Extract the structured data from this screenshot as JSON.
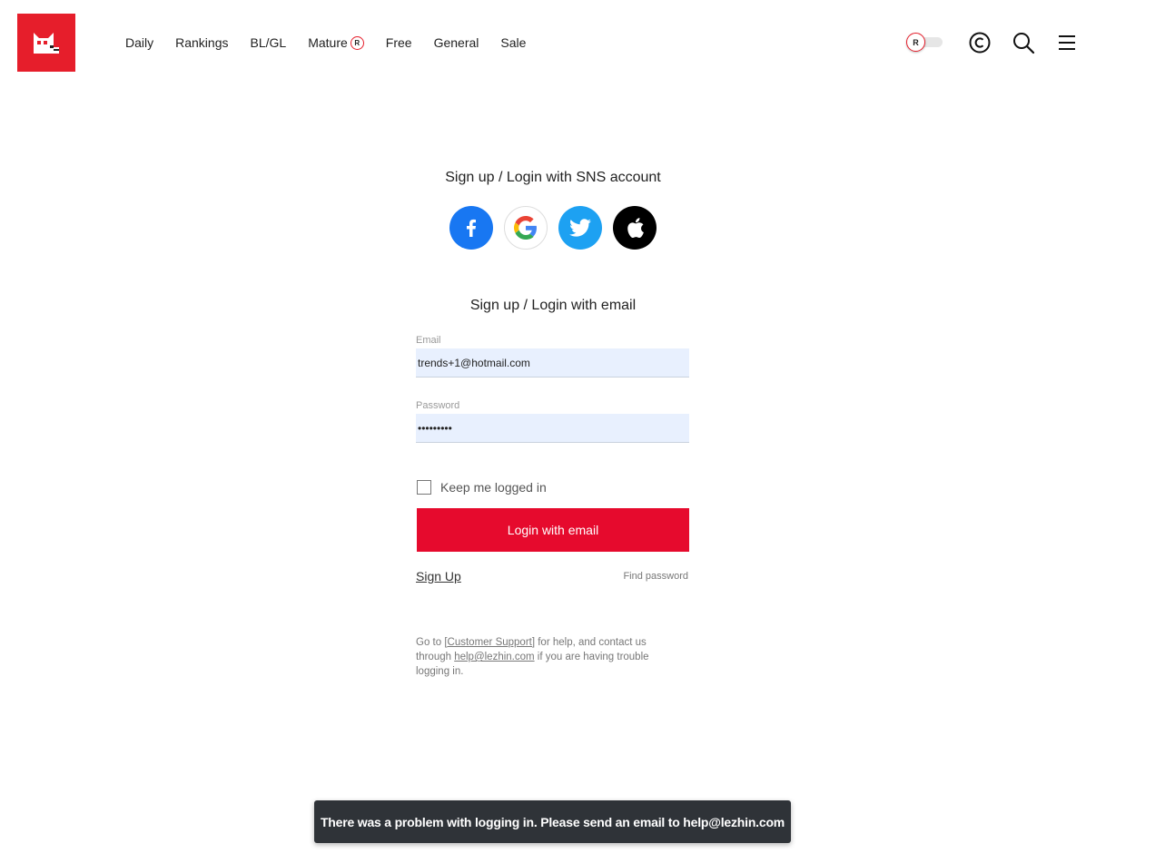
{
  "brand": {
    "accent_color": "#e61e2b",
    "logo_icon": "cat-logo-icon"
  },
  "nav": {
    "items": [
      {
        "label": "Daily"
      },
      {
        "label": "Rankings"
      },
      {
        "label": "BL/GL"
      },
      {
        "label": "Mature",
        "badge": "R"
      },
      {
        "label": "Free"
      },
      {
        "label": "General"
      },
      {
        "label": "Sale"
      }
    ]
  },
  "header": {
    "mature_toggle": {
      "badge": "R",
      "on": false
    },
    "icons": [
      "copyright-icon",
      "search-icon",
      "hamburger-menu-icon"
    ]
  },
  "sns": {
    "title": "Sign up / Login with SNS account",
    "providers": [
      {
        "name": "facebook-icon",
        "color": "#1877f2"
      },
      {
        "name": "google-icon",
        "color": "#ffffff"
      },
      {
        "name": "twitter-icon",
        "color": "#1da1f2"
      },
      {
        "name": "apple-icon",
        "color": "#000000"
      }
    ]
  },
  "email_login": {
    "title": "Sign up / Login with email",
    "email_label": "Email",
    "email_value": "trends+1@hotmail.com",
    "password_label": "Password",
    "password_value": "•••••••••",
    "keep_logged_in": "Keep me logged in",
    "login_button": "Login with email",
    "sign_up": "Sign Up",
    "find_password": "Find password"
  },
  "help": {
    "prefix": "Go to ",
    "support_link": "[Customer Support]",
    "middle": " for help, and contact us through ",
    "email_link": "help@lezhin.com",
    "suffix": " if you are having trouble logging in."
  },
  "toast": {
    "message": "There was a problem with logging in. Please send an email to help@lezhin.com"
  }
}
